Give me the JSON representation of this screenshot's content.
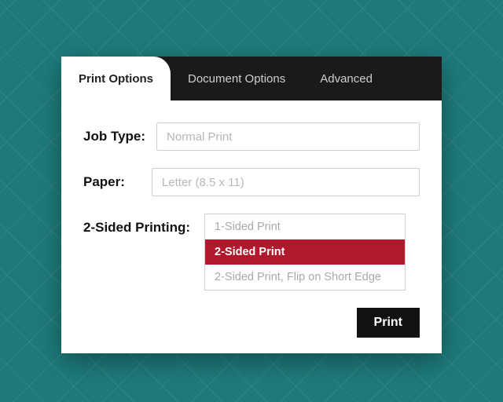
{
  "tabs": {
    "items": [
      {
        "label": "Print Options",
        "active": true
      },
      {
        "label": "Document Options",
        "active": false
      },
      {
        "label": "Advanced",
        "active": false
      }
    ]
  },
  "form": {
    "job_type": {
      "label": "Job Type:",
      "value": "Normal Print"
    },
    "paper": {
      "label": "Paper:",
      "value": "Letter (8.5 x 11)"
    },
    "two_sided": {
      "label": "2-Sided Printing:",
      "options": [
        "1-Sided Print",
        "2-Sided Print",
        "2-Sided Print, Flip on Short Edge"
      ],
      "selected_index": 1
    }
  },
  "actions": {
    "print_label": "Print"
  },
  "colors": {
    "accent_red": "#b2182b",
    "tab_bar_bg": "#1a1a1a",
    "page_bg": "#1e7a7a"
  }
}
